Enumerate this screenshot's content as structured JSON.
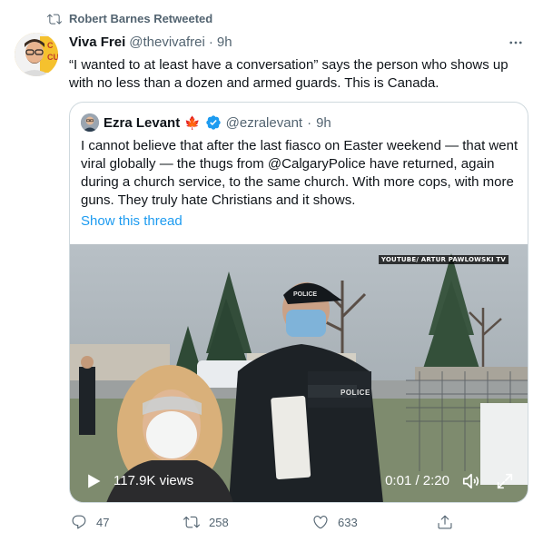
{
  "retweet_banner": {
    "label": "Robert Barnes Retweeted",
    "icon": "retweet-icon"
  },
  "tweet": {
    "author_name": "Viva Frei",
    "author_handle": "@thevivafrei",
    "separator": "·",
    "time": "9h",
    "text": "“I wanted to at least have a conversation” says the person who shows up with no less than a dozen and armed guards. This is Canada.",
    "more_icon": "more-horizontal-icon"
  },
  "quoted_tweet": {
    "author_name": "Ezra Levant",
    "flag_emoji": "🍁",
    "verified_icon": "verified-badge-icon",
    "author_handle": "@ezralevant",
    "separator": "·",
    "time": "9h",
    "text": "I cannot believe that after the last fiasco on Easter weekend — that went viral globally — the thugs from @CalgaryPolice have returned, again during a church service, to the same church. With more cops, with more guns. They truly hate Christians and it shows.",
    "show_thread": "Show this thread"
  },
  "video": {
    "watermark": "YOUTUBE/ ARTUR PAWLOWSKI TV",
    "views": "117.9K views",
    "time": "0:01 / 2:20",
    "vest_label": "POLICE",
    "cap_label": "POLICE"
  },
  "actions": {
    "reply_count": "47",
    "retweet_count": "258",
    "like_count": "633"
  },
  "colors": {
    "accent": "#1d9bf0",
    "secondary_text": "#536471",
    "border": "#cfd9de",
    "maple_leaf": "#e0245e"
  }
}
